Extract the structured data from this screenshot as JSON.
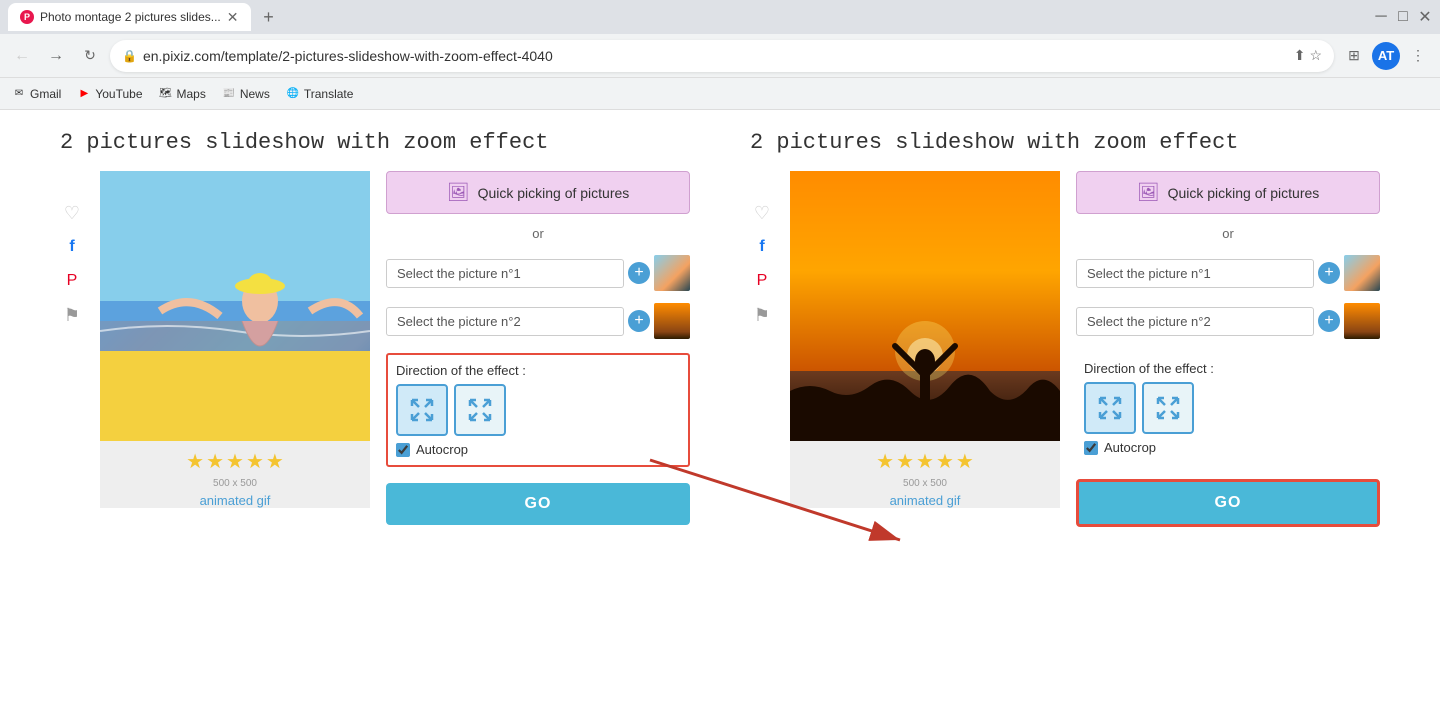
{
  "browser": {
    "tab_title": "Photo montage 2 pictures slides...",
    "favicon_text": "P",
    "url": "en.pixiz.com/template/2-pictures-slideshow-with-zoom-effect-4040",
    "window_controls": [
      "minimize",
      "maximize",
      "close"
    ],
    "bookmarks": [
      {
        "label": "Gmail",
        "icon": "✉"
      },
      {
        "label": "YouTube",
        "icon": "▶"
      },
      {
        "label": "Maps",
        "icon": "🗺"
      },
      {
        "label": "News",
        "icon": "📰"
      },
      {
        "label": "Translate",
        "icon": "🌐"
      }
    ]
  },
  "left_section": {
    "title": "2 pictures slideshow with zoom effect",
    "quick_pick_label": "Quick picking of pictures",
    "or_text": "or",
    "select_picture_1": "Select the picture n°1",
    "select_picture_2": "Select the picture n°2",
    "direction_label": "Direction of the effect :",
    "autocrop_label": "Autocrop",
    "go_label": "GO",
    "stars": 5,
    "size": "500 x 500",
    "animated_gif": "animated gif"
  },
  "right_section": {
    "title": "2 pictures slideshow with zoom effect",
    "quick_pick_label": "Quick picking of pictures",
    "or_text": "or",
    "select_picture_1": "Select the picture n°1",
    "select_picture_2": "Select the picture n°2",
    "direction_label": "Direction of the effect :",
    "autocrop_label": "Autocrop",
    "go_label": "GO",
    "stars": 5,
    "size": "500 x 500",
    "animated_gif": "animated gif"
  },
  "colors": {
    "accent_blue": "#4ab8d8",
    "quick_pick_bg": "#f0d0f0",
    "highlight_red": "#e74c3c",
    "star_color": "#f4c430",
    "direction_btn_blue": "#4a9fd5"
  }
}
